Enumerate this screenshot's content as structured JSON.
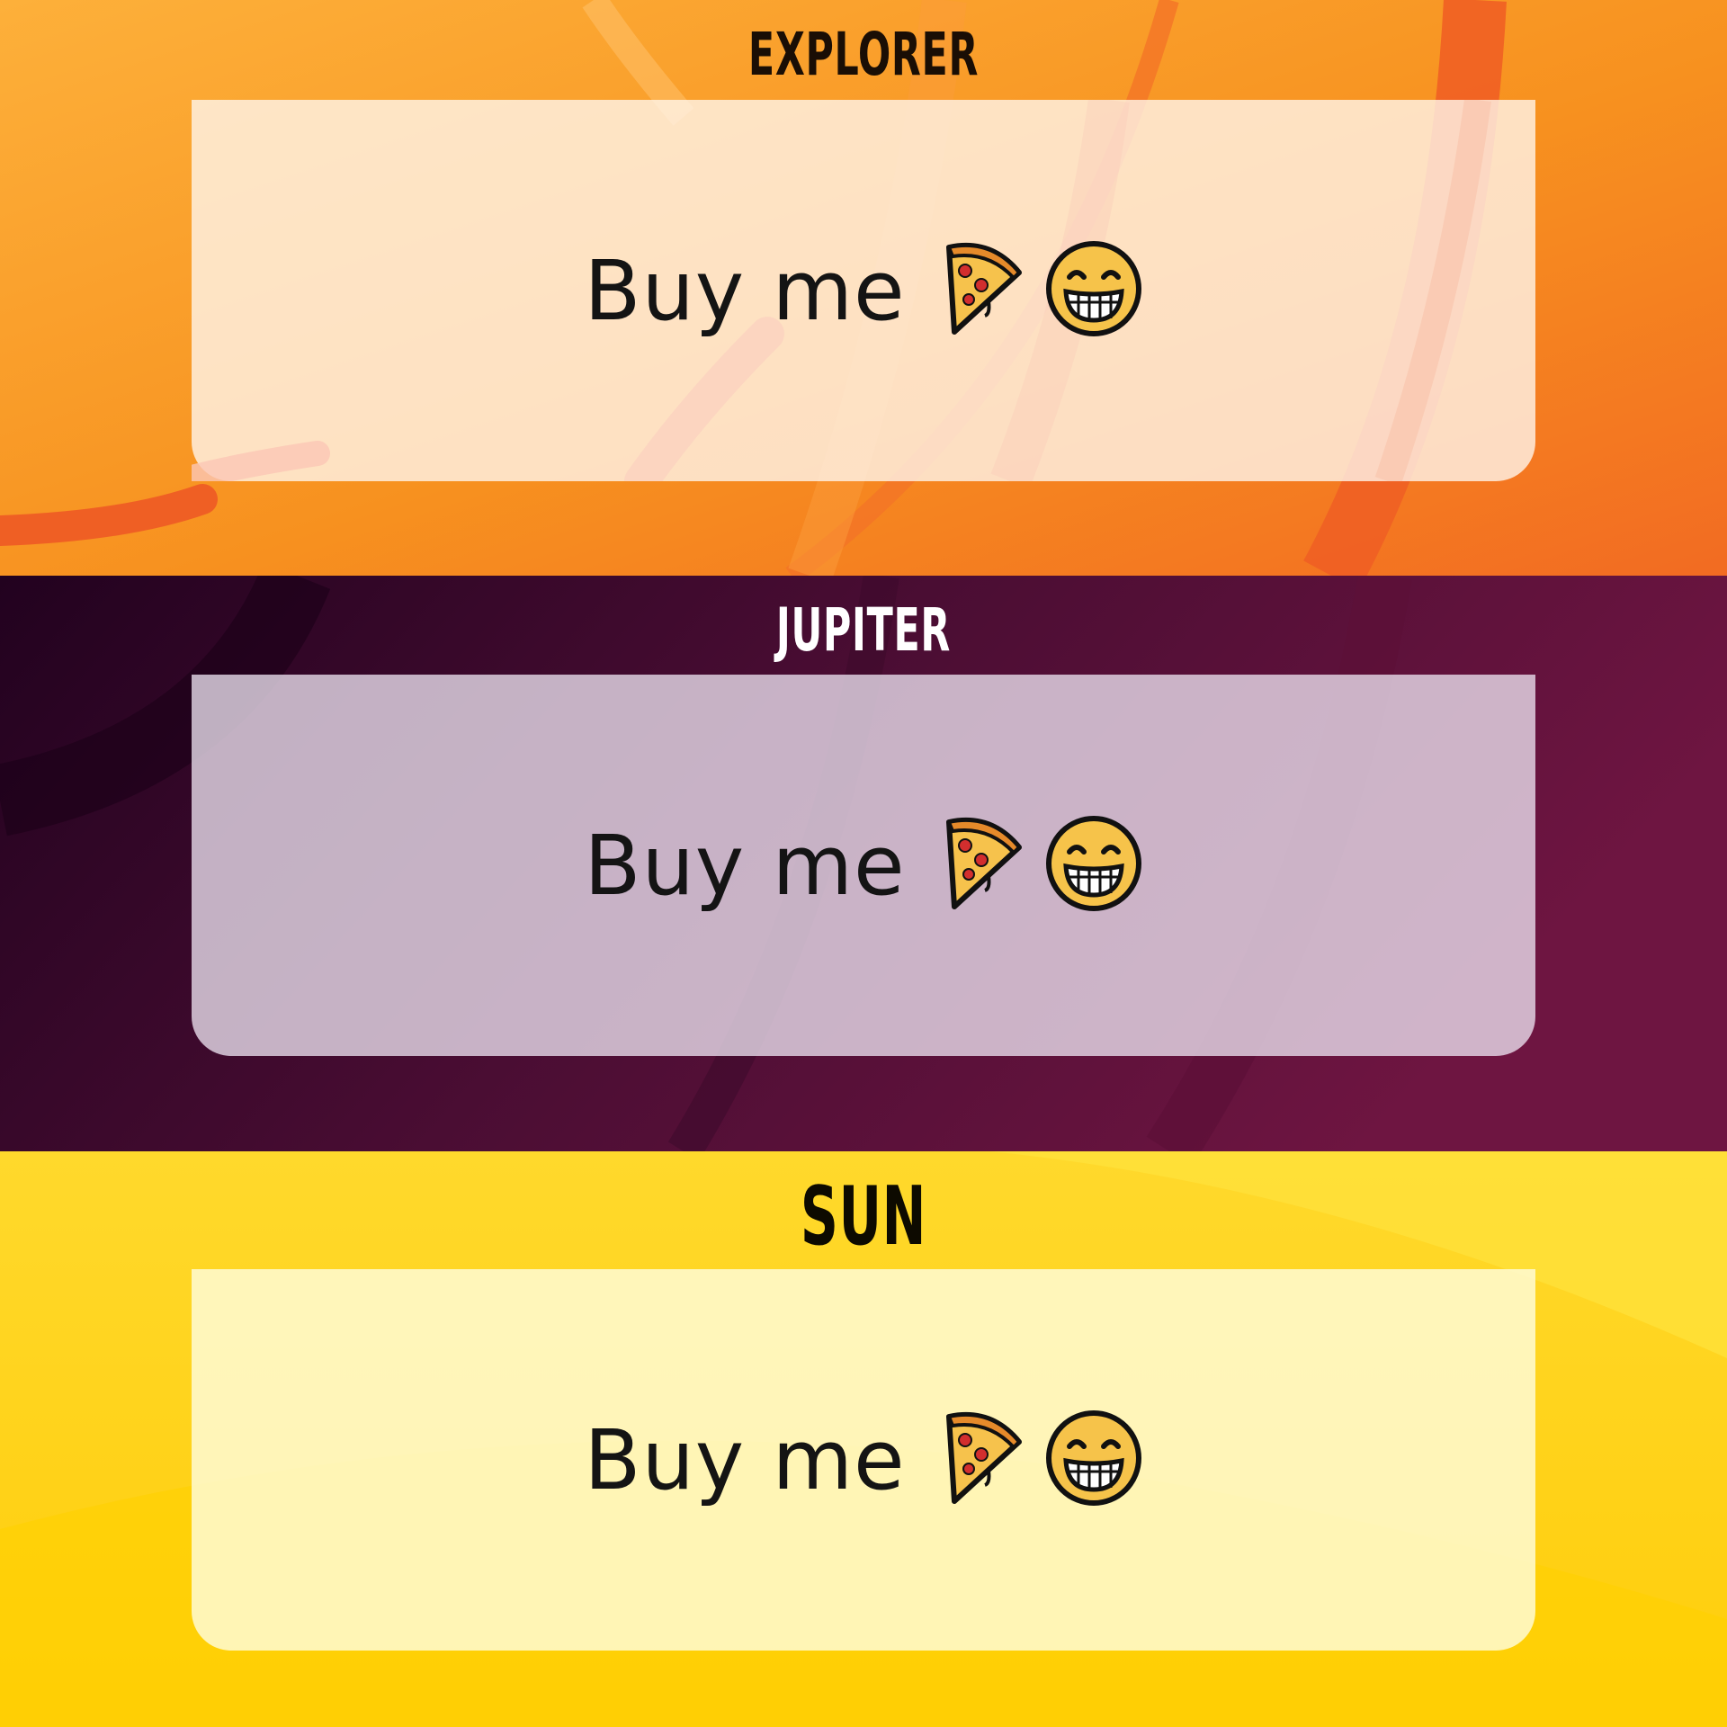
{
  "themes": [
    {
      "id": "explorer",
      "title": "EXPLORER",
      "button_label": "Buy me",
      "accent": "#f7901e"
    },
    {
      "id": "jupiter",
      "title": "JUPITER",
      "button_label": "Buy me",
      "accent": "#5a1038"
    },
    {
      "id": "sun",
      "title": "SUN",
      "button_label": "Buy me",
      "accent": "#ffd21e"
    }
  ],
  "icons": [
    "pizza-icon",
    "grinning-face-icon"
  ]
}
